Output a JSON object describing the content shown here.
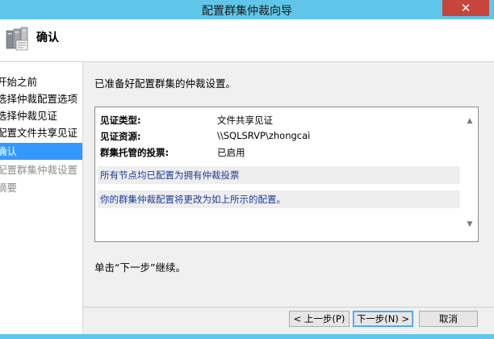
{
  "window": {
    "title": "配置群集仲裁向导",
    "close_glyph": "✕"
  },
  "header": {
    "title": "确认",
    "icon": "cluster-servers-icon"
  },
  "nav": {
    "items": [
      {
        "label": "开始之前",
        "state": "normal"
      },
      {
        "label": "选择仲裁配置选项",
        "state": "normal"
      },
      {
        "label": "选择仲裁见证",
        "state": "normal"
      },
      {
        "label": "配置文件共享见证",
        "state": "normal"
      },
      {
        "label": "确认",
        "state": "active"
      },
      {
        "label": "配置群集仲裁设置",
        "state": "disabled"
      },
      {
        "label": "摘要",
        "state": "disabled"
      }
    ]
  },
  "main": {
    "intro": "已准备好配置群集的仲裁设置。",
    "summary": {
      "rows": [
        {
          "key": "见证类型:",
          "value": "文件共享见证"
        },
        {
          "key": "见证资源:",
          "value": "\\\\SQLSRVP\\zhongcai"
        },
        {
          "key": "群集托管的投票:",
          "value": "已启用"
        }
      ],
      "notes": [
        "所有节点均已配置为拥有仲裁投票",
        "你的群集仲裁配置将更改为如上所示的配置。"
      ]
    },
    "next_note": "单击“下一步”继续。"
  },
  "buttons": {
    "prev": "< 上一步(P)",
    "next": "下一步(N) >",
    "cancel": "取消"
  },
  "colors": {
    "titlebar": "#5fc6e9",
    "close": "#c7453b",
    "nav_active": "#3399ff",
    "note_text": "#1f3b9a"
  }
}
